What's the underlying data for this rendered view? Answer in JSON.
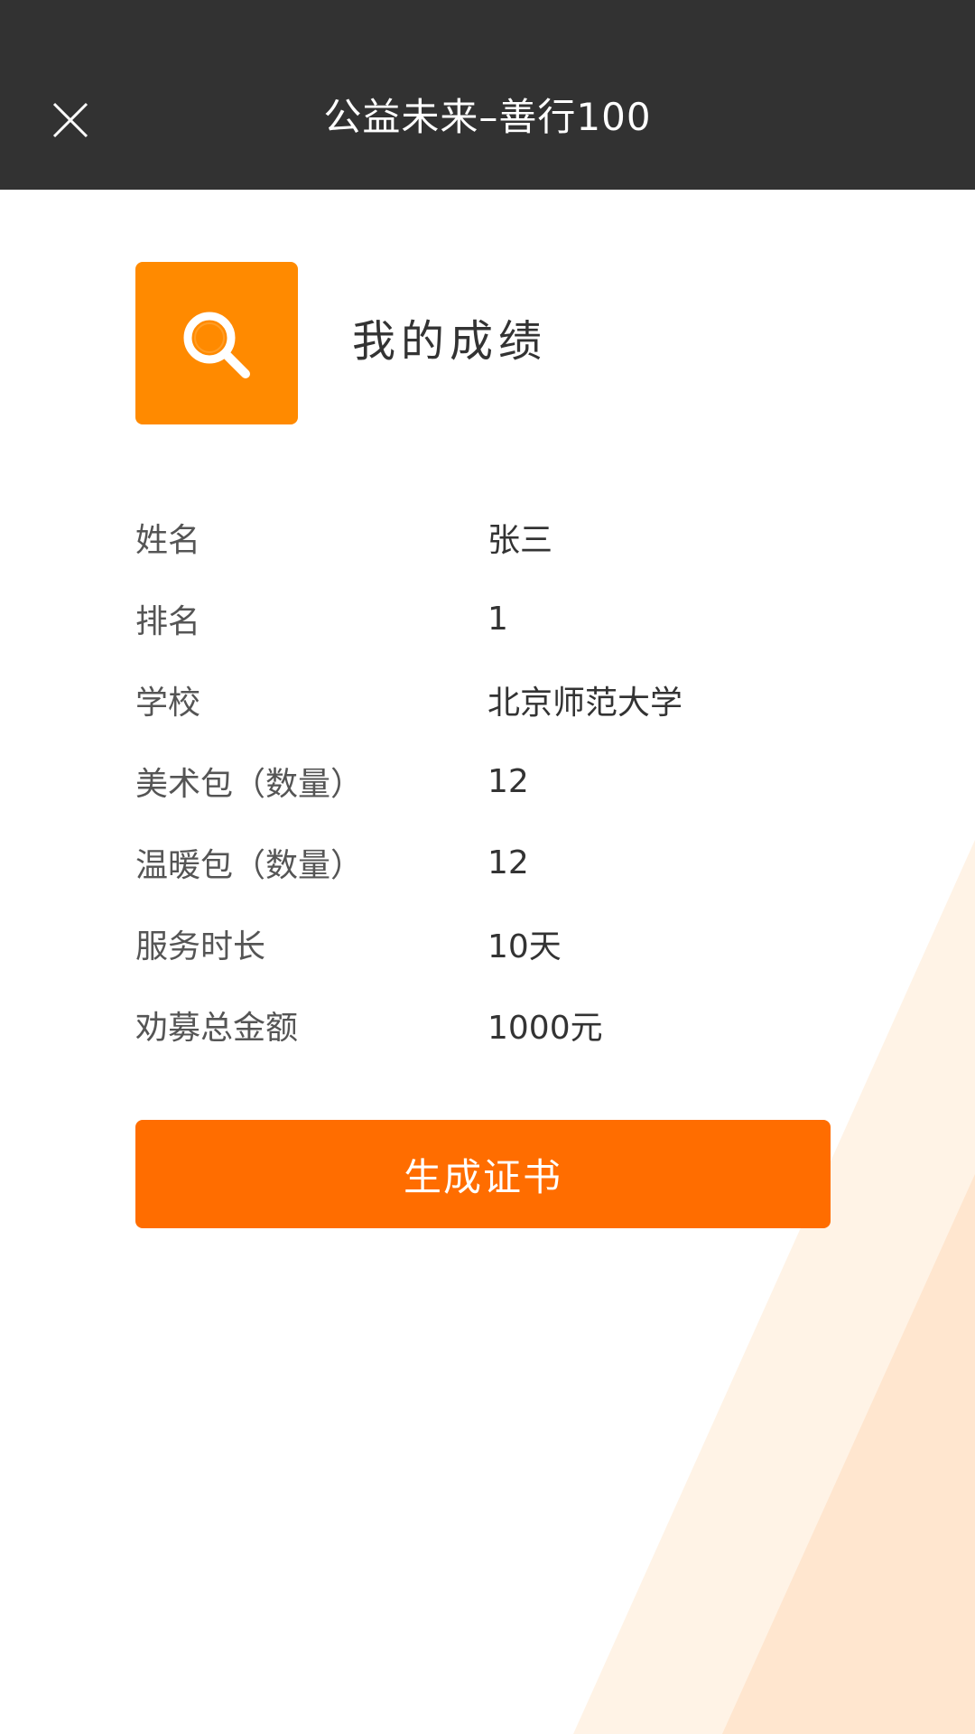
{
  "header": {
    "title": "公益未来–善行100"
  },
  "section": {
    "title": "我的成绩",
    "icon": "search-icon"
  },
  "info": [
    {
      "label": "姓名",
      "value": "张三"
    },
    {
      "label": "排名",
      "value": "1"
    },
    {
      "label": "学校",
      "value": "北京师范大学"
    },
    {
      "label": "美术包（数量）",
      "value": "12"
    },
    {
      "label": "温暖包（数量）",
      "value": "12"
    },
    {
      "label": "服务时长",
      "value": "10天"
    },
    {
      "label": "劝募总金额",
      "value": "1000元"
    }
  ],
  "actions": {
    "generate_label": "生成证书"
  },
  "colors": {
    "header_bg": "#323232",
    "accent": "#ff6d00",
    "icon_bg": "#ff8a00",
    "decor_light": "#fff3e6",
    "decor_mid": "#ffe6cf"
  }
}
